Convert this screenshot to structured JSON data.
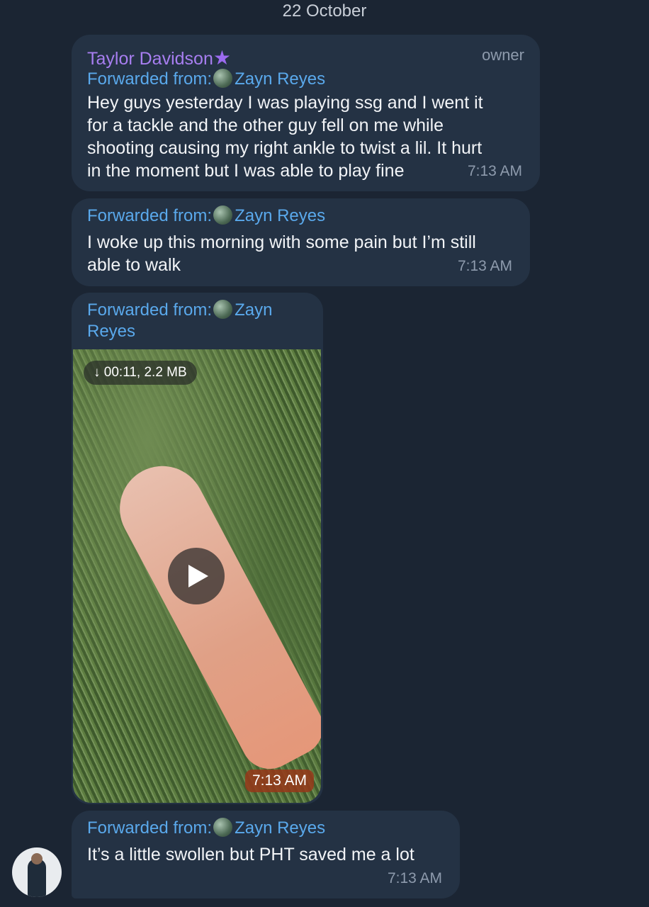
{
  "date_label": "22 October",
  "messages": [
    {
      "sender": "Taylor Davidson",
      "role": "owner",
      "forwarded_label": "Forwarded from:",
      "forwarded_name": "Zayn Reyes",
      "lines": [
        "Hey guys yesterday I was playing ssg and I went it",
        "for a tackle and the other guy fell on me while",
        "shooting causing my right ankle to twist a lil. It hurt",
        "in the moment but I was able to play fine"
      ],
      "time": "7:13 AM"
    },
    {
      "forwarded_label": "Forwarded from:",
      "forwarded_name": "Zayn Reyes",
      "lines": [
        "I woke up this morning with some pain but I’m still",
        "able to walk"
      ],
      "time": "7:13 AM"
    },
    {
      "forwarded_label": "Forwarded from:",
      "forwarded_name_part1": "Zayn",
      "forwarded_name_part2": "Reyes",
      "video": {
        "download_info": "00:11, 2.2 MB",
        "time": "7:13 AM"
      }
    },
    {
      "forwarded_label": "Forwarded from:",
      "forwarded_name": "Zayn Reyes",
      "lines": [
        "It’s a little swollen but PHT saved me a lot"
      ],
      "time": "7:13 AM"
    }
  ],
  "colors": {
    "background": "#1b2533",
    "bubble": "#243244",
    "forward_link": "#5aa9ec",
    "sender": "#a77ef0",
    "time": "#8e9bad"
  }
}
